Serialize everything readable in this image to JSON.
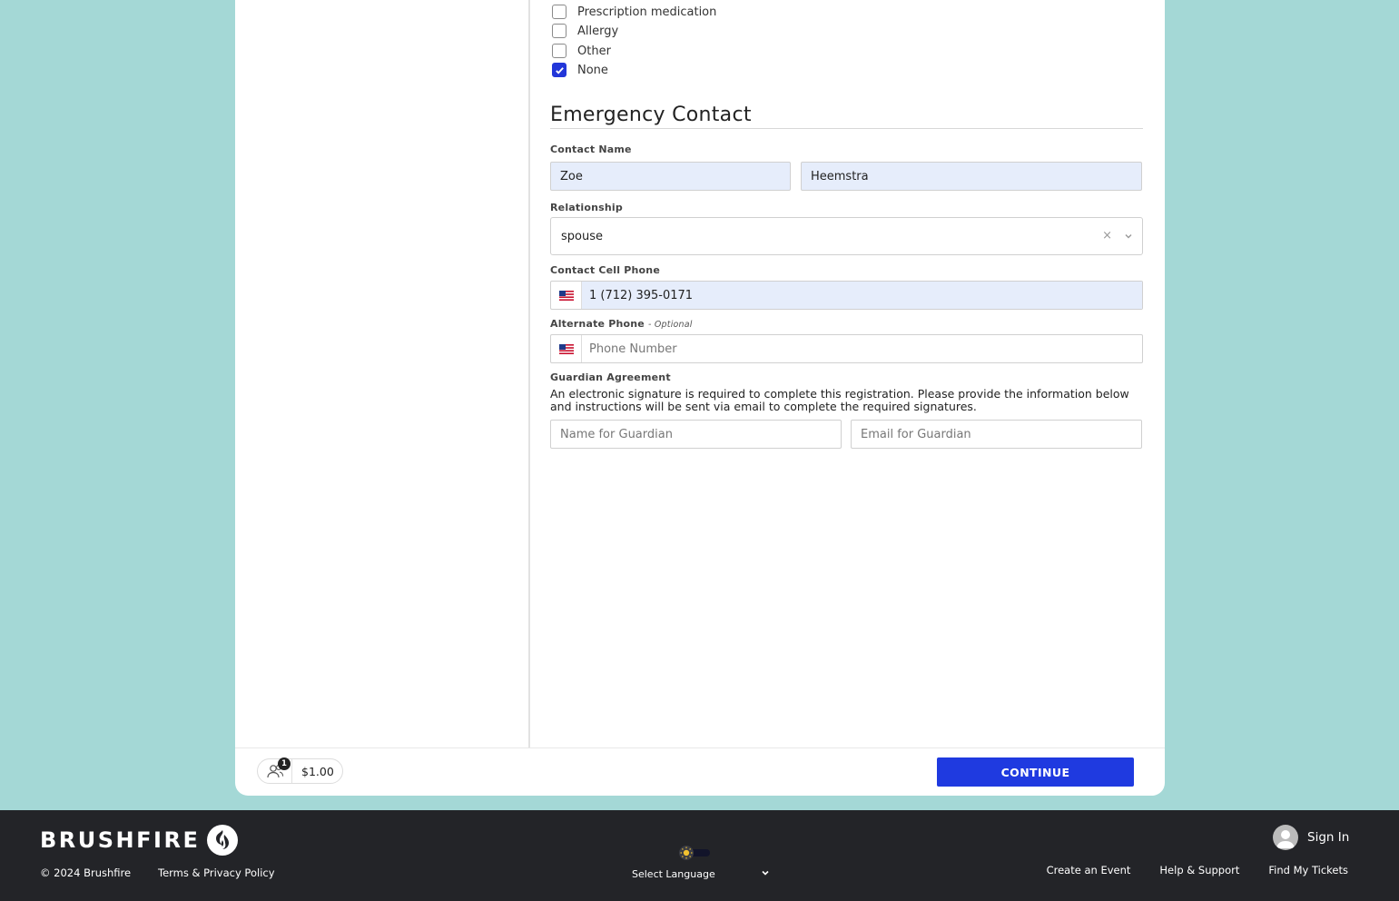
{
  "checkboxes": [
    {
      "label": "Prescription medication",
      "checked": false
    },
    {
      "label": "Allergy",
      "checked": false
    },
    {
      "label": "Other",
      "checked": false
    },
    {
      "label": "None",
      "checked": true
    }
  ],
  "emergency": {
    "title": "Emergency Contact",
    "contact_name_label": "Contact Name",
    "first_name": "Zoe",
    "last_name": "Heemstra",
    "relationship_label": "Relationship",
    "relationship_value": "spouse",
    "clear_symbol": "×",
    "cell_label": "Contact Cell Phone",
    "cell_value": "1 (712) 395-0171",
    "alt_label": "Alternate Phone",
    "alt_optional": "- Optional",
    "alt_placeholder": "Phone Number",
    "guardian_label": "Guardian Agreement",
    "guardian_text": "An electronic signature is required to complete this registration. Please provide the information below and instructions will be sent via email to complete the required signatures.",
    "guardian_name_placeholder": "Name for Guardian",
    "guardian_email_placeholder": "Email for Guardian"
  },
  "cart": {
    "count": "1",
    "price": "$1.00",
    "continue_label": "CONTINUE"
  },
  "footer": {
    "logo_text": "BRUSHFIRE",
    "copyright": "© 2024 Brushfire",
    "terms": "Terms & Privacy Policy",
    "language": "Select Language",
    "sign_in": "Sign In",
    "links": [
      "Create an Event",
      "Help & Support",
      "Find My Tickets"
    ]
  },
  "colors": {
    "background": "#a4d8d6",
    "accent": "#1f3ae0",
    "filled_input": "#e6edfb",
    "footer": "#232428"
  },
  "icons": [
    "check-icon",
    "chevron-down-icon",
    "us-flag-icon",
    "people-icon",
    "brushfire-flame-icon",
    "sun-icon",
    "user-avatar-icon"
  ]
}
